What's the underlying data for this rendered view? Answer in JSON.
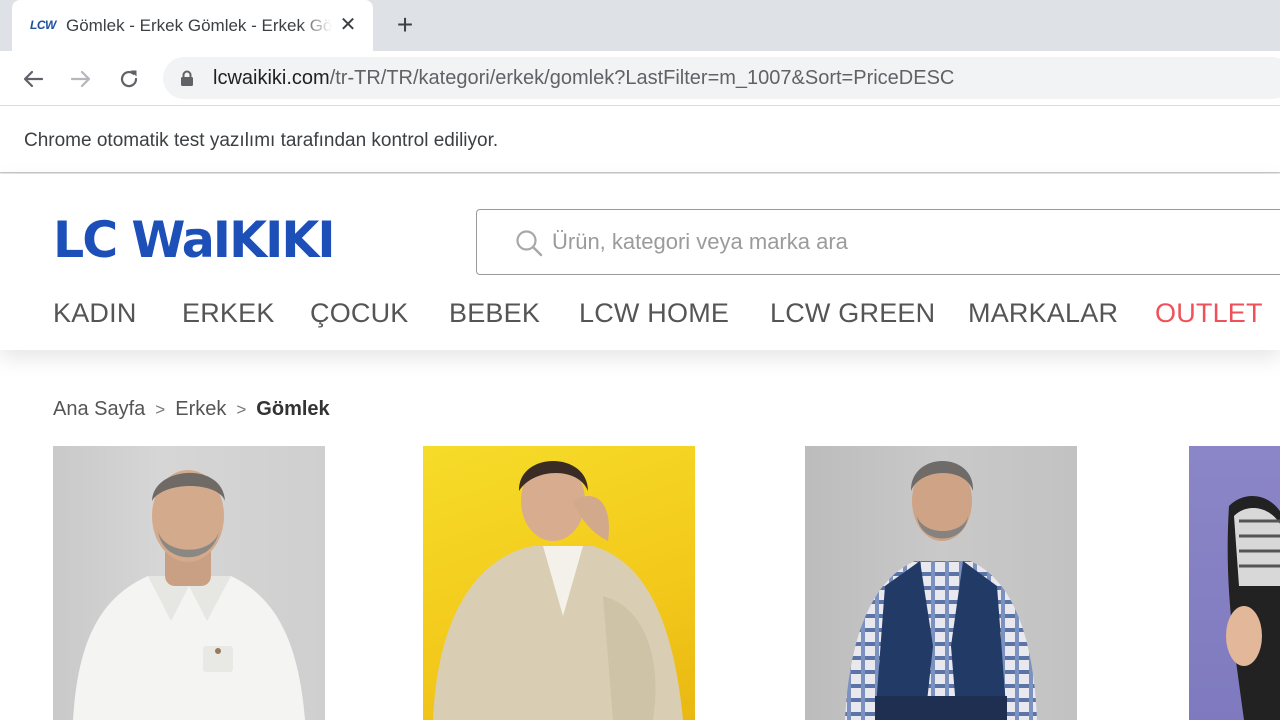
{
  "browser": {
    "tab": {
      "favicon_text": "LCW",
      "title": "Gömlek - Erkek Gömlek - Erkek Gömlek",
      "close_glyph": "✕"
    },
    "new_tab_glyph": "+",
    "url_host": "lcwaikiki.com",
    "url_path": "/tr-TR/TR/kategori/erkek/gomlek?LastFilter=m_1007&Sort=PriceDESC",
    "infobar_text": "Chrome otomatik test yazılımı tarafından kontrol ediliyor."
  },
  "site": {
    "logo_text": "LC WaIKIKI",
    "brand_color": "#1d4fb8",
    "search": {
      "placeholder": "Ürün, kategori veya marka ara"
    },
    "nav": [
      {
        "label": "KADIN"
      },
      {
        "label": "ERKEK"
      },
      {
        "label": "ÇOCUK"
      },
      {
        "label": "BEBEK"
      },
      {
        "label": "LCW HOME"
      },
      {
        "label": "LCW GREEN"
      },
      {
        "label": "MARKALAR"
      },
      {
        "label": "OUTLET",
        "color": "#f0505a"
      }
    ]
  },
  "breadcrumb": [
    {
      "label": "Ana Sayfa"
    },
    {
      "label": "Erkek"
    },
    {
      "label": "Gömlek"
    }
  ],
  "breadcrumb_separator": ">",
  "products": [
    {
      "image": "man-white-linen-shirt-photo"
    },
    {
      "image": "man-beige-jacket-yellow-background-photo"
    },
    {
      "image": "man-plaid-shirt-navy-vest-photo"
    },
    {
      "image": "model-purple-background-photo"
    }
  ]
}
